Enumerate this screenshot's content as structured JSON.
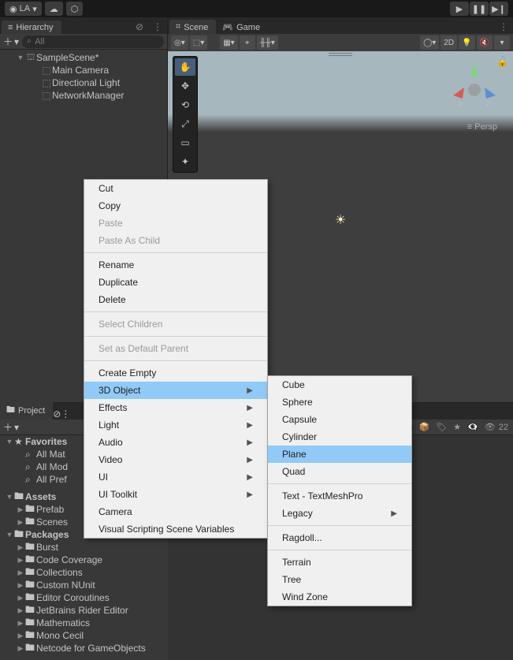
{
  "topbar": {
    "account_label": "LA"
  },
  "hierarchy": {
    "tab_label": "Hierarchy",
    "search_placeholder": "All",
    "scene_name": "SampleScene*",
    "items": [
      "Main Camera",
      "Directional Light",
      "NetworkManager"
    ]
  },
  "scene": {
    "tab_scene": "Scene",
    "tab_game": "Game",
    "mode_2d": "2D",
    "persp_label": "Persp"
  },
  "project": {
    "tab_label": "Project",
    "favorites_label": "Favorites",
    "fav_items": [
      "All Mat",
      "All Mod",
      "All Pref"
    ],
    "assets_label": "Assets",
    "asset_items": [
      "Prefab",
      "Scenes"
    ],
    "packages_label": "Packages",
    "package_items": [
      "Burst",
      "Code Coverage",
      "Collections",
      "Custom NUnit",
      "Editor Coroutines",
      "JetBrains Rider Editor",
      "Mathematics",
      "Mono Cecil",
      "Netcode for GameObjects"
    ],
    "visible_count": "22"
  },
  "context_menu": {
    "groups": [
      [
        {
          "label": "Cut"
        },
        {
          "label": "Copy"
        },
        {
          "label": "Paste",
          "disabled": true
        },
        {
          "label": "Paste As Child",
          "disabled": true
        }
      ],
      [
        {
          "label": "Rename"
        },
        {
          "label": "Duplicate"
        },
        {
          "label": "Delete"
        }
      ],
      [
        {
          "label": "Select Children",
          "disabled": true
        }
      ],
      [
        {
          "label": "Set as Default Parent",
          "disabled": true
        }
      ],
      [
        {
          "label": "Create Empty"
        },
        {
          "label": "3D Object",
          "submenu": true,
          "hover": true
        },
        {
          "label": "Effects",
          "submenu": true
        },
        {
          "label": "Light",
          "submenu": true
        },
        {
          "label": "Audio",
          "submenu": true
        },
        {
          "label": "Video",
          "submenu": true
        },
        {
          "label": "UI",
          "submenu": true
        },
        {
          "label": "UI Toolkit",
          "submenu": true
        },
        {
          "label": "Camera"
        },
        {
          "label": "Visual Scripting Scene Variables"
        }
      ]
    ],
    "submenu": {
      "groups": [
        [
          {
            "label": "Cube"
          },
          {
            "label": "Sphere"
          },
          {
            "label": "Capsule"
          },
          {
            "label": "Cylinder"
          },
          {
            "label": "Plane",
            "hover": true
          },
          {
            "label": "Quad"
          }
        ],
        [
          {
            "label": "Text - TextMeshPro"
          },
          {
            "label": "Legacy",
            "submenu": true
          }
        ],
        [
          {
            "label": "Ragdoll..."
          }
        ],
        [
          {
            "label": "Terrain"
          },
          {
            "label": "Tree"
          },
          {
            "label": "Wind Zone"
          }
        ]
      ]
    }
  }
}
